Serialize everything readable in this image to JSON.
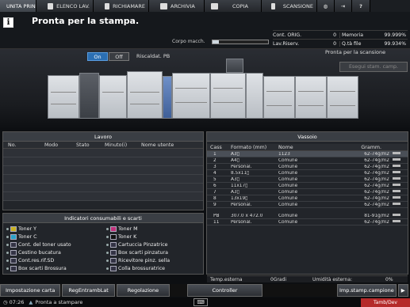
{
  "tabs": [
    "UNITA PRINC.",
    "ELENCO LAV.",
    "RICHIAMARE",
    "ARCHIVIA",
    "COPIA",
    "SCANSIONE"
  ],
  "status": {
    "message": "Pronta per la stampa.",
    "corpo_label": "Corpo macch.",
    "corpo_level": 0.12
  },
  "counters": [
    {
      "l1": "Cont. ORIG.",
      "v1": "0",
      "l2": "Memoria",
      "v2": "99.999%"
    },
    {
      "l1": "Lav.Riserv.",
      "v1": "0",
      "l2": "Q.tà file",
      "v2": "99.934%"
    }
  ],
  "machine": {
    "on": "On",
    "off": "Off",
    "riscald": "Riscaldat. PB",
    "scan_status": "Pronta per la scansione",
    "esegui": "Esegui stam. camp."
  },
  "lavoro": {
    "title": "Lavoro",
    "cols": [
      "No.",
      "Modo",
      "Stato",
      "Minuto(i)",
      "Nome utente"
    ]
  },
  "consumi": {
    "title": "Indicatori consumabili e scarti",
    "items": [
      "Toner Y",
      "Toner C",
      "Cont. del toner usato",
      "Cestino bucatura",
      "Cont.res.rif.SD",
      "Box scarti Brossura",
      "Toner M",
      "Toner K",
      "Cartuccia Pinzatrice",
      "Box scarti pinzatura",
      "Ricevitore pinz. sella",
      "Colla brossuratrice"
    ]
  },
  "vassoio": {
    "title": "Vassoio",
    "cols": [
      "Cass",
      "Formato (mm)",
      "Nome",
      "Gramm."
    ],
    "rows": [
      [
        "1",
        "A3▯",
        "1123",
        "62-74g/m2"
      ],
      [
        "2",
        "A4▯",
        "Comune",
        "62-74g/m2"
      ],
      [
        "3",
        "Personal.",
        "Comune",
        "62-74g/m2"
      ],
      [
        "4",
        "8.5x11▯",
        "Comune",
        "62-74g/m2"
      ],
      [
        "5",
        "A3▯",
        "Comune",
        "62-74g/m2"
      ],
      [
        "6",
        "11x17▯",
        "Comune",
        "62-74g/m2"
      ],
      [
        "7",
        "A3▯",
        "Comune",
        "62-74g/m2"
      ],
      [
        "8",
        "13x19▯",
        "Comune",
        "62-74g/m2"
      ],
      [
        "9",
        "Personal.",
        "Comune",
        "62-74g/m2"
      ],
      [
        "PB",
        "307.0 x 472.0",
        "Comune",
        "81-91g/m2"
      ],
      [
        "11",
        "Personal.",
        "Comune",
        "62-74g/m2"
      ]
    ],
    "temp_label": "Temp.esterna",
    "temp_val": "0Gradi",
    "umid_label": "Umidità esterna:",
    "umid_val": "0%"
  },
  "buttons": [
    "Impostazione carta",
    "RegEntrambLat",
    "Regolazione",
    "Controller",
    "Imp.stamp.campione"
  ],
  "system": {
    "time": "07:26",
    "status": "Pronta a stampare",
    "badge": "Tamb/Dev"
  }
}
